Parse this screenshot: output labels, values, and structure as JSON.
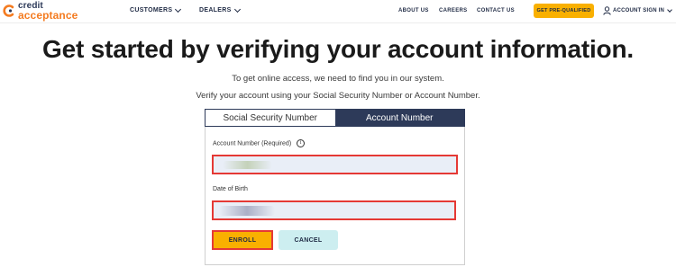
{
  "header": {
    "logo_top": "credit",
    "logo_bottom": "acceptance",
    "nav": [
      {
        "label": "CUSTOMERS"
      },
      {
        "label": "DEALERS"
      }
    ],
    "links": [
      {
        "label": "ABOUT US"
      },
      {
        "label": "CAREERS"
      },
      {
        "label": "CONTACT US"
      }
    ],
    "prequal_label": "GET PRE-QUALIFIED",
    "signin_label": "ACCOUNT SIGN IN"
  },
  "main": {
    "title": "Get started by verifying your account information.",
    "subtitle1": "To get online access, we need to find you in our system.",
    "subtitle2": "Verify your account using your Social Security Number or Account Number.",
    "tabs": [
      {
        "label": "Social Security Number",
        "active": false
      },
      {
        "label": "Account Number",
        "active": true
      }
    ],
    "form": {
      "account_label": "Account Number (Required)",
      "info_symbol": "i",
      "account_value": "",
      "dob_label": "Date of Birth",
      "dob_value": "",
      "enroll_label": "ENROLL",
      "cancel_label": "CANCEL"
    }
  },
  "colors": {
    "navy": "#2d3a59",
    "orange": "#f47b20",
    "yellow": "#f9b000",
    "highlight_red": "#e53935",
    "cancel_bg": "#cdeef0",
    "field_bg": "#e9eef7"
  }
}
